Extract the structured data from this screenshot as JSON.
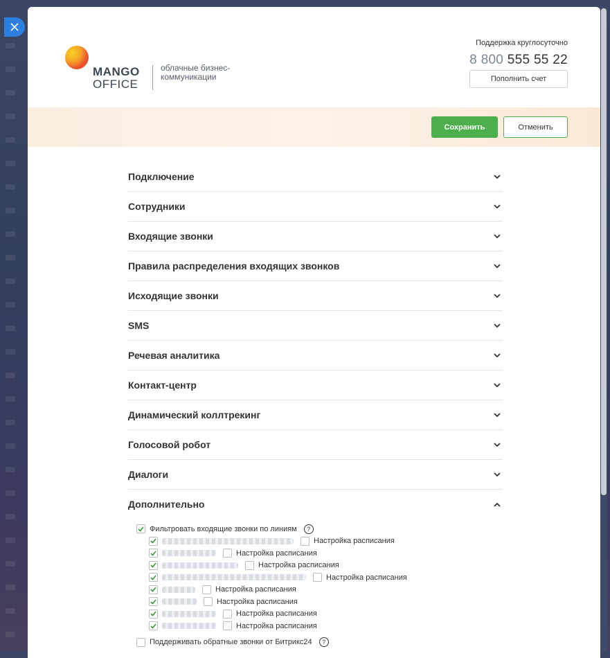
{
  "brand": {
    "name_line1": "MANGO",
    "name_line2": "OFFICE",
    "tagline": "облачные бизнес-коммуникации"
  },
  "support": {
    "label": "Поддержка круглосуточно",
    "phone_prefix": "8 800",
    "phone_number": "555 55 22",
    "topup_label": "Пополнить счет"
  },
  "actions": {
    "save_label": "Сохранить",
    "cancel_label": "Отменить"
  },
  "sections": [
    {
      "label": "Подключение",
      "expanded": false
    },
    {
      "label": "Сотрудники",
      "expanded": false
    },
    {
      "label": "Входящие звонки",
      "expanded": false
    },
    {
      "label": "Правила распределения входящих звонков",
      "expanded": false
    },
    {
      "label": "Исходящие звонки",
      "expanded": false
    },
    {
      "label": "SMS",
      "expanded": false
    },
    {
      "label": "Речевая аналитика",
      "expanded": false
    },
    {
      "label": "Контакт-центр",
      "expanded": false
    },
    {
      "label": "Динамический коллтрекинг",
      "expanded": false
    },
    {
      "label": "Голосовой робот",
      "expanded": false
    },
    {
      "label": "Диалоги",
      "expanded": false
    },
    {
      "label": "Дополнительно",
      "expanded": true
    }
  ],
  "options": {
    "filter_lines": {
      "label": "Фильтровать входящие звонки по линиям",
      "checked": true
    },
    "schedule_label": "Настройка расписания",
    "lines": [
      {
        "checked": true,
        "schedule_checked": false
      },
      {
        "checked": true,
        "schedule_checked": false
      },
      {
        "checked": true,
        "schedule_checked": false
      },
      {
        "checked": true,
        "schedule_checked": false
      },
      {
        "checked": true,
        "schedule_checked": false
      },
      {
        "checked": true,
        "schedule_checked": false
      },
      {
        "checked": true,
        "schedule_checked": false
      },
      {
        "checked": true,
        "schedule_checked": false
      }
    ],
    "bitrix_callbacks": {
      "label": "Поддерживать обратные звонки от Битрикс24",
      "checked": false
    }
  },
  "colors": {
    "accent_green": "#4cae4c",
    "close_blue": "#2d7fe0"
  }
}
